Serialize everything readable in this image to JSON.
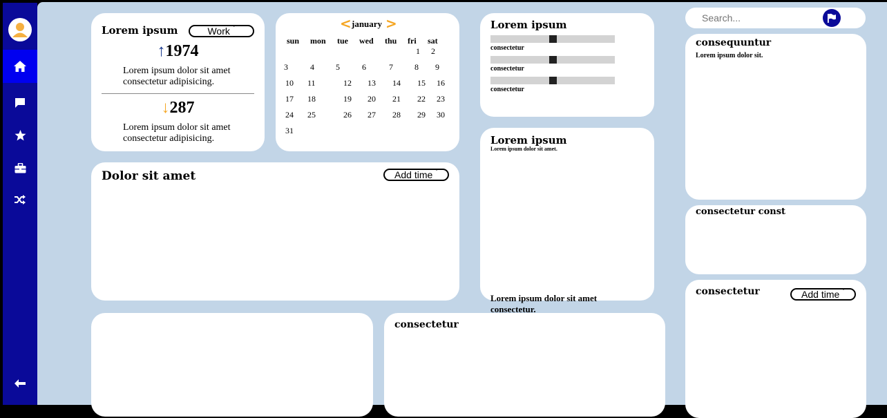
{
  "sidebar": {
    "avatar_icon": "user-icon",
    "items": [
      {
        "name": "home",
        "icon": "home-icon",
        "active": true
      },
      {
        "name": "messages",
        "icon": "chat-icon"
      },
      {
        "name": "favorites",
        "icon": "star-icon"
      },
      {
        "name": "toolbox",
        "icon": "toolbox-icon"
      },
      {
        "name": "shuffle",
        "icon": "shuffle-icon"
      }
    ],
    "logout_icon": "logout-arrow-icon"
  },
  "stats_card": {
    "title": "Lorem ipsum",
    "dropdown": "Work",
    "up": {
      "arrow": "↑",
      "value": "1974",
      "desc_1": "Lorem ipsum dolor sit amet",
      "desc_2": "consectetur adipisicing."
    },
    "down": {
      "arrow": "↓",
      "value": "287",
      "desc_1": "Lorem ipsum dolor sit amet",
      "desc_2": "consectetur adipisicing."
    }
  },
  "calendar": {
    "prev": "<",
    "next": ">",
    "month": "january",
    "weekdays": [
      "sun",
      "mon",
      "tue",
      "wed",
      "thu",
      "fri",
      "sat"
    ],
    "days": [
      "1",
      "2",
      "3",
      "4",
      "5",
      "6",
      "7",
      "8",
      "9",
      "10",
      "11",
      "12",
      "13",
      "14",
      "15",
      "16",
      "17",
      "18",
      "19",
      "20",
      "21",
      "22",
      "23",
      "24",
      "25",
      "26",
      "27",
      "28",
      "29",
      "30",
      "31"
    ]
  },
  "sliders_card": {
    "title": "Lorem ipsum",
    "sliders": [
      {
        "label": "consectetur",
        "value": 0.5
      },
      {
        "label": "consectetur",
        "value": 0.5
      },
      {
        "label": "consectetur",
        "value": 0.5
      }
    ]
  },
  "time_card": {
    "title": "Dolor sit amet",
    "dropdown": "Add time"
  },
  "middle_card": {
    "title": "Lorem ipsum",
    "subtitle": "Lorem ipsum dolor sit amet.",
    "footer_1": "Lorem ipsum dolor sit amet",
    "footer_2": "consectetur."
  },
  "bottom_right_card": {
    "title": "consectetur"
  },
  "search": {
    "placeholder": "Search...",
    "flag_icon": "flag-icon"
  },
  "right_cards": [
    {
      "title": "consequuntur",
      "text": "Lorem ipsum dolor sit."
    },
    {
      "title": "consectetur const"
    },
    {
      "title": "consectetur",
      "dropdown": "Add time"
    }
  ],
  "colors": {
    "sidebar": "#0a0a99",
    "sidebar_active": "#0000f0",
    "background": "#c2d5e7",
    "accent_orange": "#f5a623",
    "up_arrow": "#1a3a8f",
    "flag_button": "#0a0a99"
  }
}
